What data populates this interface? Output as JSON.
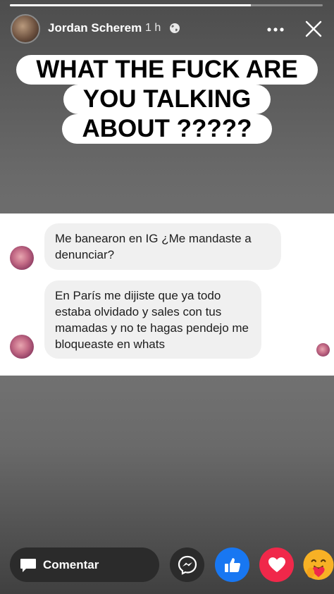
{
  "story": {
    "progress": 0.77
  },
  "header": {
    "user_name": "Jordan Scherem",
    "time": "1 h",
    "privacy_icon": "globe-icon",
    "more_icon": "more-icon",
    "close_icon": "close-icon"
  },
  "caption": {
    "lines": [
      "WHAT THE FUCK ARE",
      "YOU TALKING",
      "ABOUT ?????"
    ]
  },
  "chat": {
    "messages": [
      "Me banearon en IG ¿Me mandaste a denunciar?",
      "En París me dijiste que ya todo estaba olvidado y sales con tus mamadas y no te hagas pendejo me bloqueaste en whats"
    ]
  },
  "footer": {
    "comment_label": "Comentar",
    "reactions": [
      "messenger-icon",
      "like-icon",
      "love-icon",
      "care-icon"
    ]
  },
  "colors": {
    "like": "#1877f2",
    "love": "#f0284a",
    "bubble": "#f0f0f0"
  }
}
